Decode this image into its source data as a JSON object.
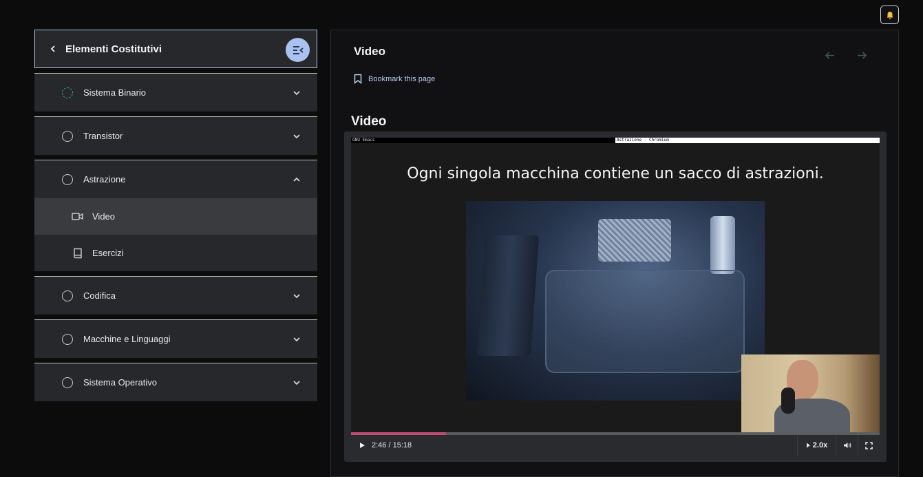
{
  "sidebar": {
    "title": "Elementi Costitutivi",
    "sections": [
      {
        "label": "Sistema Binario"
      },
      {
        "label": "Transistor"
      },
      {
        "label": "Astrazione",
        "items": [
          {
            "label": "Video"
          },
          {
            "label": "Esercizi"
          }
        ]
      },
      {
        "label": "Codifica"
      },
      {
        "label": "Macchine e Linguaggi"
      },
      {
        "label": "Sistema Operativo"
      }
    ]
  },
  "main": {
    "page_title": "Video",
    "bookmark_label": "Bookmark this page",
    "section_title": "Video"
  },
  "video": {
    "window_left_title": "GNU Emacs",
    "window_right_title": "Astrazione - Chromium",
    "slide_text": "Ogni singola macchina contiene un sacco di astrazioni.",
    "time": "2:46 / 15:18",
    "speed": "2.0x",
    "progress": 0.18
  },
  "colors": {
    "accent": "#a9c2f0",
    "progress_fill": "#c04e74",
    "in_progress": "#3fae7a"
  }
}
